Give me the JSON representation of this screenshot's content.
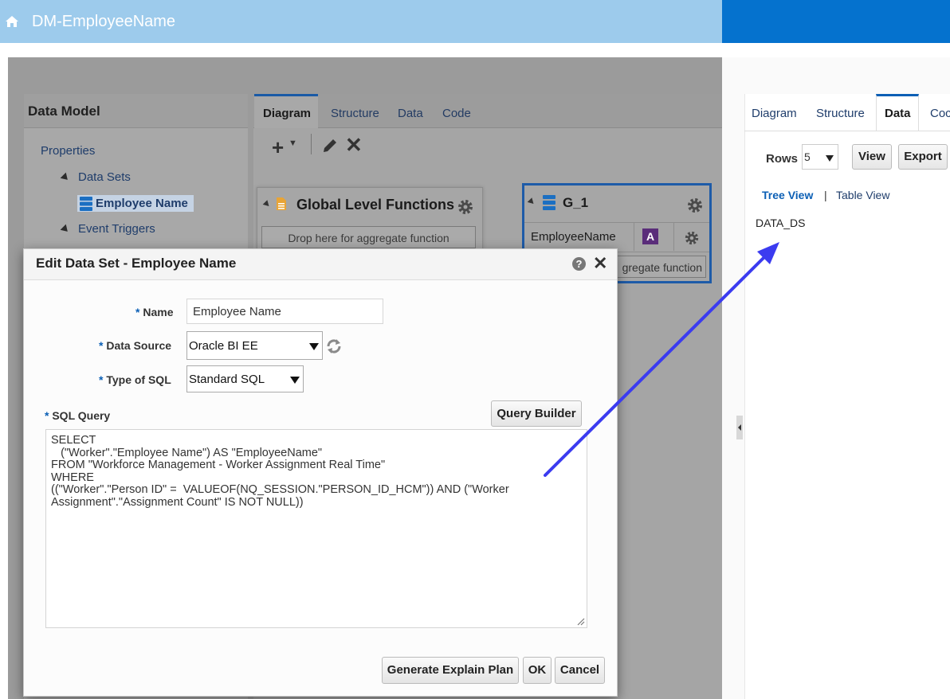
{
  "header": {
    "title": "DM-EmployeeName",
    "home_icon": "home-icon"
  },
  "data_model": {
    "title": "Data Model",
    "tree": {
      "properties": "Properties",
      "data_sets": "Data Sets",
      "employee_name": "Employee Name",
      "event_triggers": "Event Triggers"
    }
  },
  "center": {
    "tabs": [
      "Diagram",
      "Structure",
      "Data",
      "Code"
    ],
    "active_tab": "Diagram",
    "toolbar": {
      "add_label": "+",
      "delete_label": "✕"
    },
    "global_functions": {
      "title": "Global Level Functions",
      "drop_text": "Drop here for aggregate function"
    },
    "group": {
      "title": "G_1",
      "field": "EmployeeName",
      "type_badge": "A",
      "drop_text": "gregate function"
    }
  },
  "right": {
    "tabs": [
      "Diagram",
      "Structure",
      "Data",
      "Coc"
    ],
    "active_tab": "Data",
    "rows_label": "Rows",
    "rows_value": "5",
    "view_button": "View",
    "export_button": "Export",
    "tree_view": "Tree View",
    "separator": "|",
    "table_view": "Table View",
    "data_root": "DATA_DS"
  },
  "dialog": {
    "title": "Edit Data Set - Employee Name",
    "help": "?",
    "close": "✕",
    "required_mark": "*",
    "name_label": "Name",
    "name_value": "Employee Name",
    "data_source_label": "Data Source",
    "data_source_value": "Oracle BI EE",
    "type_label": "Type of SQL",
    "type_value": "Standard SQL",
    "sql_label": "SQL Query",
    "query_builder": "Query Builder",
    "sql_text": "SELECT\n   (\"Worker\".\"Employee Name\") AS \"EmployeeName\"\nFROM \"Workforce Management - Worker Assignment Real Time\"\nWHERE\n((\"Worker\".\"Person ID\" =  VALUEOF(NQ_SESSION.\"PERSON_ID_HCM\")) AND (\"Worker\nAssignment\".\"Assignment Count\" IS NOT NULL))",
    "buttons": {
      "explain": "Generate Explain Plan",
      "ok": "OK",
      "cancel": "Cancel"
    }
  },
  "colors": {
    "header_light": "#9dcbec",
    "header_dark": "#0572ce",
    "accent": "#0b5fb5",
    "arrow": "#3b3bf0"
  }
}
